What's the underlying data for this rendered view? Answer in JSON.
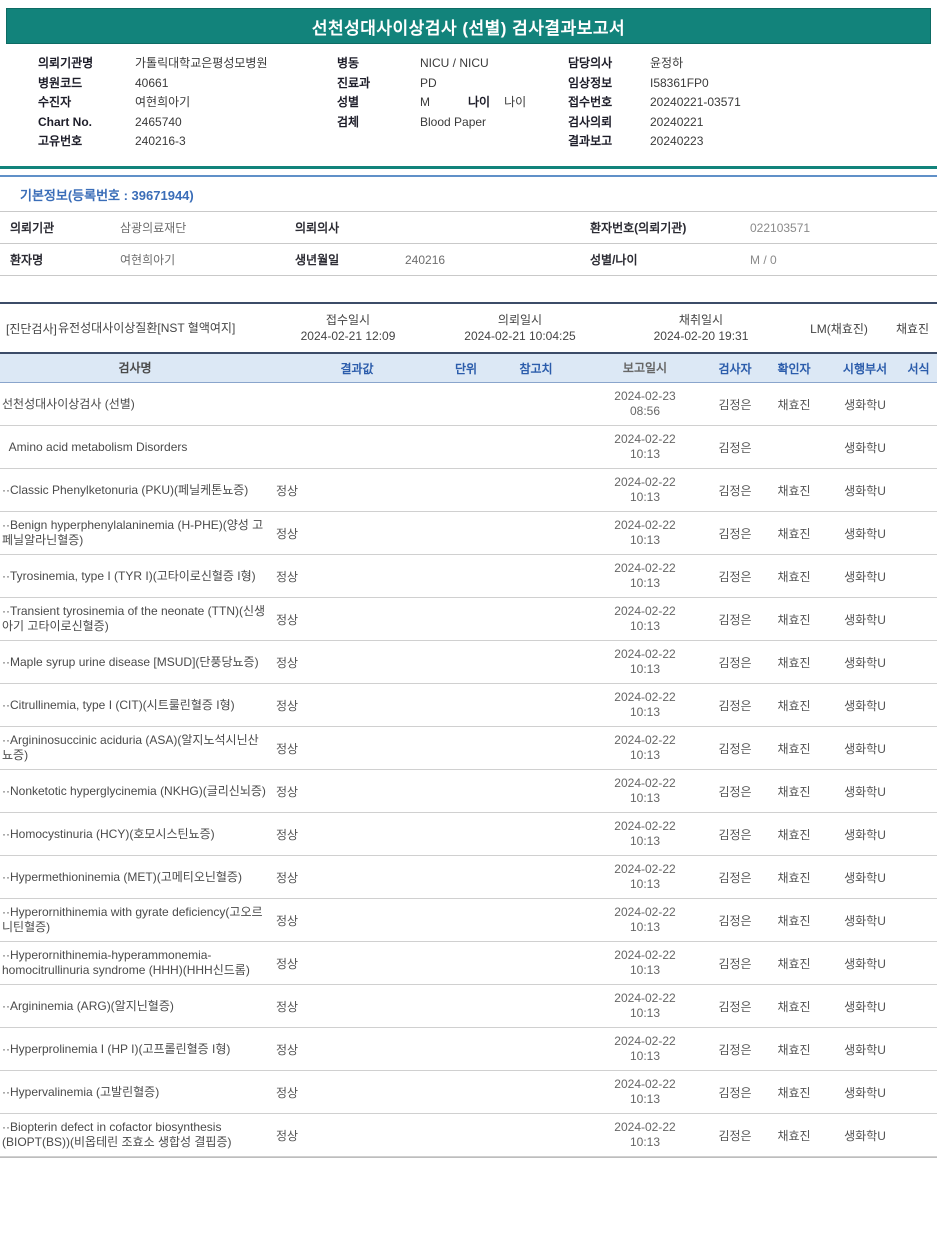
{
  "colors": {
    "accent_teal": "#12837b",
    "section_blue_border": "#6090c8",
    "section_blue_text": "#3a6db8",
    "table_header_bg": "#dce8f5",
    "table_header_text": "#2b5cab"
  },
  "title": "선천성대사이상검사 (선별) 검사결과보고서",
  "patient_header": {
    "left": [
      {
        "label": "의뢰기관명",
        "value": "가톨릭대학교은평성모병원"
      },
      {
        "label": "병원코드",
        "value": "40661"
      },
      {
        "label": "수진자",
        "value": "여현희아기"
      },
      {
        "label": "Chart No.",
        "value": "2465740"
      },
      {
        "label": "고유번호",
        "value": "240216-3"
      }
    ],
    "middle": [
      {
        "label": "병동",
        "value": "NICU / NICU"
      },
      {
        "label": "진료과",
        "value": "PD"
      },
      {
        "label": "성별",
        "value": "M",
        "label2": "나이",
        "value2": "나이"
      },
      {
        "label": "검체",
        "value": "Blood Paper"
      }
    ],
    "right": [
      {
        "label": "담당의사",
        "value": "윤정하"
      },
      {
        "label": "임상정보",
        "value": "I58361FP0"
      },
      {
        "label": "접수번호",
        "value": "20240221-03571"
      },
      {
        "label": "검사의뢰",
        "value": "20240221"
      },
      {
        "label": "결과보고",
        "value": "20240223"
      }
    ]
  },
  "basic_info": {
    "section_title": "기본정보(등록번호 : 39671944)",
    "rows": [
      {
        "cells": [
          {
            "label": "의뢰기관",
            "value": "삼광의료재단"
          },
          {
            "label": "의뢰의사",
            "value": ""
          },
          {
            "label": "환자번호(의뢰기관)",
            "value": "022103571"
          }
        ]
      },
      {
        "cells": [
          {
            "label": "환자명",
            "value": "여현희아기"
          },
          {
            "label": "생년월일",
            "value": "240216"
          },
          {
            "label": "성별/나이",
            "value": "M / 0"
          }
        ]
      }
    ]
  },
  "order": {
    "tag": "[진단검사]",
    "test_name": "유전성대사이상질환[NST 혈액여지]",
    "receipt": {
      "label": "접수일시",
      "value": "2024-02-21 12:09"
    },
    "request": {
      "label": "의뢰일시",
      "value": "2024-02-21 10:04:25"
    },
    "collection": {
      "label": "채취일시",
      "value": "2024-02-20 19:31"
    },
    "collector": "LM(채효진)",
    "phlebotomist": "채효진"
  },
  "results": {
    "headers": [
      "검사명",
      "결과값",
      "단위",
      "참고치",
      "보고일시",
      "검사자",
      "확인자",
      "시행부서",
      "서식"
    ],
    "rows": [
      {
        "name": "선천성대사이상검사 (선별)",
        "result": "",
        "unit": "",
        "ref": "",
        "reported_date": "2024-02-23",
        "reported_time": "08:56",
        "tester": "김정은",
        "confirmer": "채효진",
        "dept": "생화학U",
        "form": ""
      },
      {
        "name": "  Amino acid metabolism Disorders",
        "result": "",
        "unit": "",
        "ref": "",
        "reported_date": "2024-02-22",
        "reported_time": "10:13",
        "tester": "김정은",
        "confirmer": "",
        "dept": "생화학U",
        "form": ""
      },
      {
        "name": "··Classic Phenylketonuria (PKU)(페닐케톤뇨증)",
        "result": "정상",
        "unit": "",
        "ref": "",
        "reported_date": "2024-02-22",
        "reported_time": "10:13",
        "tester": "김정은",
        "confirmer": "채효진",
        "dept": "생화학U",
        "form": ""
      },
      {
        "name": "··Benign hyperphenylalaninemia (H-PHE)(양성 고페닐알라닌혈증)",
        "result": "정상",
        "unit": "",
        "ref": "",
        "reported_date": "2024-02-22",
        "reported_time": "10:13",
        "tester": "김정은",
        "confirmer": "채효진",
        "dept": "생화학U",
        "form": ""
      },
      {
        "name": "··Tyrosinemia, type I (TYR I)(고타이로신혈증 I형)",
        "result": "정상",
        "unit": "",
        "ref": "",
        "reported_date": "2024-02-22",
        "reported_time": "10:13",
        "tester": "김정은",
        "confirmer": "채효진",
        "dept": "생화학U",
        "form": ""
      },
      {
        "name": "··Transient tyrosinemia of the neonate (TTN)(신생아기 고타이로신혈증)",
        "result": "정상",
        "unit": "",
        "ref": "",
        "reported_date": "2024-02-22",
        "reported_time": "10:13",
        "tester": "김정은",
        "confirmer": "채효진",
        "dept": "생화학U",
        "form": ""
      },
      {
        "name": "··Maple syrup urine disease [MSUD](단풍당뇨증)",
        "result": "정상",
        "unit": "",
        "ref": "",
        "reported_date": "2024-02-22",
        "reported_time": "10:13",
        "tester": "김정은",
        "confirmer": "채효진",
        "dept": "생화학U",
        "form": ""
      },
      {
        "name": "··Citrullinemia, type I (CIT)(시트룰린혈증 I형)",
        "result": "정상",
        "unit": "",
        "ref": "",
        "reported_date": "2024-02-22",
        "reported_time": "10:13",
        "tester": "김정은",
        "confirmer": "채효진",
        "dept": "생화학U",
        "form": ""
      },
      {
        "name": "··Argininosuccinic aciduria (ASA)(알지노석시닌산뇨증)",
        "result": "정상",
        "unit": "",
        "ref": "",
        "reported_date": "2024-02-22",
        "reported_time": "10:13",
        "tester": "김정은",
        "confirmer": "채효진",
        "dept": "생화학U",
        "form": ""
      },
      {
        "name": "··Nonketotic hyperglycinemia (NKHG)(글리신뇌증)",
        "result": "정상",
        "unit": "",
        "ref": "",
        "reported_date": "2024-02-22",
        "reported_time": "10:13",
        "tester": "김정은",
        "confirmer": "채효진",
        "dept": "생화학U",
        "form": ""
      },
      {
        "name": "··Homocystinuria (HCY)(호모시스틴뇨증)",
        "result": "정상",
        "unit": "",
        "ref": "",
        "reported_date": "2024-02-22",
        "reported_time": "10:13",
        "tester": "김정은",
        "confirmer": "채효진",
        "dept": "생화학U",
        "form": ""
      },
      {
        "name": "··Hypermethioninemia (MET)(고메티오닌혈증)",
        "result": "정상",
        "unit": "",
        "ref": "",
        "reported_date": "2024-02-22",
        "reported_time": "10:13",
        "tester": "김정은",
        "confirmer": "채효진",
        "dept": "생화학U",
        "form": ""
      },
      {
        "name": "··Hyperornithinemia with gyrate deficiency(고오르니틴혈증)",
        "result": "정상",
        "unit": "",
        "ref": "",
        "reported_date": "2024-02-22",
        "reported_time": "10:13",
        "tester": "김정은",
        "confirmer": "채효진",
        "dept": "생화학U",
        "form": ""
      },
      {
        "name": "··Hyperornithinemia-hyperammonemia-homocitrullinuria syndrome (HHH)(HHH신드롬)",
        "result": "정상",
        "unit": "",
        "ref": "",
        "reported_date": "2024-02-22",
        "reported_time": "10:13",
        "tester": "김정은",
        "confirmer": "채효진",
        "dept": "생화학U",
        "form": ""
      },
      {
        "name": "··Argininemia (ARG)(알지닌혈증)",
        "result": "정상",
        "unit": "",
        "ref": "",
        "reported_date": "2024-02-22",
        "reported_time": "10:13",
        "tester": "김정은",
        "confirmer": "채효진",
        "dept": "생화학U",
        "form": ""
      },
      {
        "name": "··Hyperprolinemia I (HP I)(고프롤린혈증 I형)",
        "result": "정상",
        "unit": "",
        "ref": "",
        "reported_date": "2024-02-22",
        "reported_time": "10:13",
        "tester": "김정은",
        "confirmer": "채효진",
        "dept": "생화학U",
        "form": ""
      },
      {
        "name": "··Hypervalinemia (고발린혈증)",
        "result": "정상",
        "unit": "",
        "ref": "",
        "reported_date": "2024-02-22",
        "reported_time": "10:13",
        "tester": "김정은",
        "confirmer": "채효진",
        "dept": "생화학U",
        "form": ""
      },
      {
        "name": "··Biopterin defect in cofactor biosynthesis (BIOPT(BS))(비옵테린 조효소 생합성 결핍증)",
        "result": "정상",
        "unit": "",
        "ref": "",
        "reported_date": "2024-02-22",
        "reported_time": "10:13",
        "tester": "김정은",
        "confirmer": "채효진",
        "dept": "생화학U",
        "form": ""
      }
    ]
  }
}
